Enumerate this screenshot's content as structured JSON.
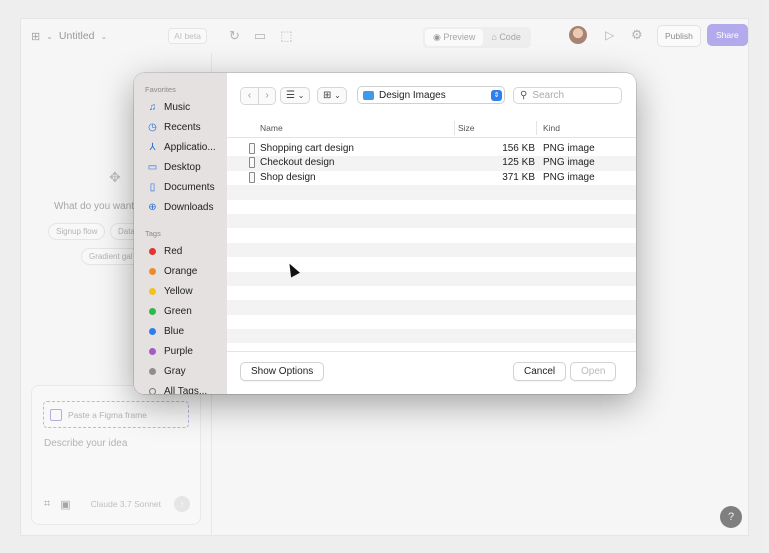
{
  "app": {
    "title": "Untitled",
    "ai_badge": "AI beta",
    "preview_label": "Preview",
    "code_label": "Code",
    "publish_label": "Publish",
    "share_label": "Share",
    "hero_text": "What do you want",
    "chips": [
      "Signup flow",
      "Data",
      "Gradient gal"
    ],
    "paste_frame": "Paste a Figma frame",
    "describe_placeholder": "Describe your idea",
    "model": "Claude 3.7 Sonnet",
    "help": "?"
  },
  "dialog": {
    "favorites_heading": "Favorites",
    "favorites": [
      {
        "label": "Music",
        "icon": "music-icon"
      },
      {
        "label": "Recents",
        "icon": "clock-icon"
      },
      {
        "label": "Applicatio...",
        "icon": "applications-icon"
      },
      {
        "label": "Desktop",
        "icon": "desktop-icon"
      },
      {
        "label": "Documents",
        "icon": "document-icon"
      },
      {
        "label": "Downloads",
        "icon": "download-icon"
      }
    ],
    "tags_heading": "Tags",
    "tags": [
      {
        "label": "Red",
        "color": "#e5312f"
      },
      {
        "label": "Orange",
        "color": "#f18a22"
      },
      {
        "label": "Yellow",
        "color": "#f4c21a"
      },
      {
        "label": "Green",
        "color": "#2db84b"
      },
      {
        "label": "Blue",
        "color": "#2c7ef0"
      },
      {
        "label": "Purple",
        "color": "#a45bc6"
      },
      {
        "label": "Gray",
        "color": "#8e8e8e"
      },
      {
        "label": "All Tags...",
        "color": ""
      }
    ],
    "location": "Design Images",
    "search_placeholder": "Search",
    "columns": {
      "name": "Name",
      "size": "Size",
      "kind": "Kind"
    },
    "files": [
      {
        "name": "Shopping cart design",
        "size": "156 KB",
        "kind": "PNG image"
      },
      {
        "name": "Checkout design",
        "size": "125 KB",
        "kind": "PNG image"
      },
      {
        "name": "Shop design",
        "size": "371 KB",
        "kind": "PNG image"
      }
    ],
    "show_options": "Show Options",
    "cancel": "Cancel",
    "open": "Open"
  }
}
